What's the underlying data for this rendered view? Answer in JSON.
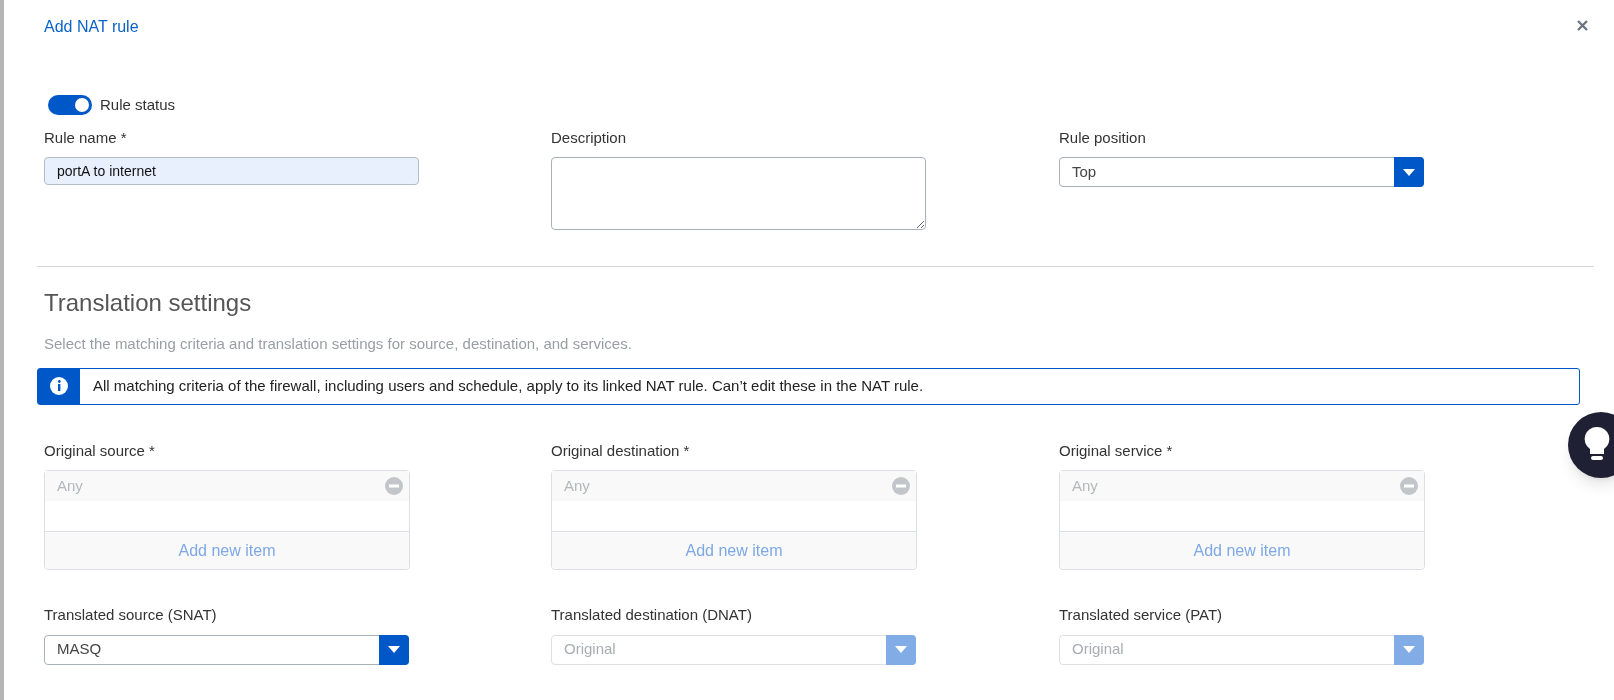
{
  "window": {
    "title": "Add NAT rule"
  },
  "rule_status": {
    "label": "Rule status",
    "on": true
  },
  "rule_name": {
    "label": "Rule name *",
    "value": "portA to internet"
  },
  "description": {
    "label": "Description"
  },
  "rule_position": {
    "label": "Rule position",
    "value": "Top",
    "disabled": false
  },
  "translation_settings": {
    "heading": "Translation settings",
    "subtitle": "Select the matching criteria and translation settings for source, destination, and services.",
    "notice": "All matching criteria of the firewall, including users and schedule, apply to its linked NAT rule. Can’t edit these in the NAT rule."
  },
  "original": [
    {
      "label": "Original source *",
      "items": [
        "Any"
      ],
      "add_label": "Add new item"
    },
    {
      "label": "Original destination *",
      "items": [
        "Any"
      ],
      "add_label": "Add new item"
    },
    {
      "label": "Original service *",
      "items": [
        "Any"
      ],
      "add_label": "Add new item"
    }
  ],
  "translated": [
    {
      "label": "Translated source (SNAT)",
      "value": "MASQ",
      "disabled": false
    },
    {
      "label": "Translated destination (DNAT)",
      "value": "Original",
      "disabled": true
    },
    {
      "label": "Translated service (PAT)",
      "value": "Original",
      "disabled": true
    }
  ]
}
